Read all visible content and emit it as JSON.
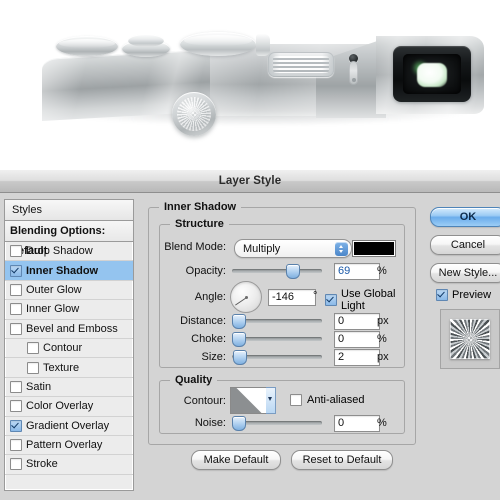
{
  "artwork": {
    "description": "3D rendered metallic camera top view with dials, grille, port and viewfinder",
    "alt": "silver-camera-render"
  },
  "window": {
    "title": "Layer Style"
  },
  "styles_panel": {
    "header": "Styles",
    "blending_options": "Blending Options: Default",
    "items": [
      {
        "label": "Drop Shadow",
        "checked": false,
        "indent": false,
        "selected": false
      },
      {
        "label": "Inner Shadow",
        "checked": true,
        "indent": false,
        "selected": true
      },
      {
        "label": "Outer Glow",
        "checked": false,
        "indent": false,
        "selected": false
      },
      {
        "label": "Inner Glow",
        "checked": false,
        "indent": false,
        "selected": false
      },
      {
        "label": "Bevel and Emboss",
        "checked": false,
        "indent": false,
        "selected": false
      },
      {
        "label": "Contour",
        "checked": false,
        "indent": true,
        "selected": false
      },
      {
        "label": "Texture",
        "checked": false,
        "indent": true,
        "selected": false
      },
      {
        "label": "Satin",
        "checked": false,
        "indent": false,
        "selected": false
      },
      {
        "label": "Color Overlay",
        "checked": false,
        "indent": false,
        "selected": false
      },
      {
        "label": "Gradient Overlay",
        "checked": true,
        "indent": false,
        "selected": false
      },
      {
        "label": "Pattern Overlay",
        "checked": false,
        "indent": false,
        "selected": false
      },
      {
        "label": "Stroke",
        "checked": false,
        "indent": false,
        "selected": false
      }
    ]
  },
  "inner_shadow": {
    "section_title": "Inner Shadow",
    "structure": {
      "section_title": "Structure",
      "blend_mode_label": "Blend Mode:",
      "blend_mode_value": "Multiply",
      "blend_color": "#000000",
      "opacity_label": "Opacity:",
      "opacity_value": "69",
      "opacity_unit": "%",
      "opacity_percent": 69,
      "angle_label": "Angle:",
      "angle_value": "-146",
      "angle_unit": "°",
      "angle_degrees": -146,
      "use_global_light_label": "Use Global Light",
      "use_global_light_checked": true,
      "distance_label": "Distance:",
      "distance_value": "0",
      "distance_unit": "px",
      "distance_percent": 0,
      "choke_label": "Choke:",
      "choke_value": "0",
      "choke_unit": "%",
      "choke_percent": 0,
      "size_label": "Size:",
      "size_value": "2",
      "size_unit": "px",
      "size_percent": 1
    },
    "quality": {
      "section_title": "Quality",
      "contour_label": "Contour:",
      "anti_aliased_label": "Anti-aliased",
      "anti_aliased_checked": false,
      "noise_label": "Noise:",
      "noise_value": "0",
      "noise_unit": "%",
      "noise_percent": 0
    },
    "make_default_label": "Make Default",
    "reset_to_default_label": "Reset to Default"
  },
  "buttons": {
    "ok_label": "OK",
    "cancel_label": "Cancel",
    "new_style_label": "New Style...",
    "preview_label": "Preview",
    "preview_checked": true
  },
  "colors": {
    "selection_blue": "#94c4ef",
    "default_button_blue": "#6badec",
    "dialog_gray": "#d4d4d4",
    "field_text_selected": "#1a59a8"
  }
}
